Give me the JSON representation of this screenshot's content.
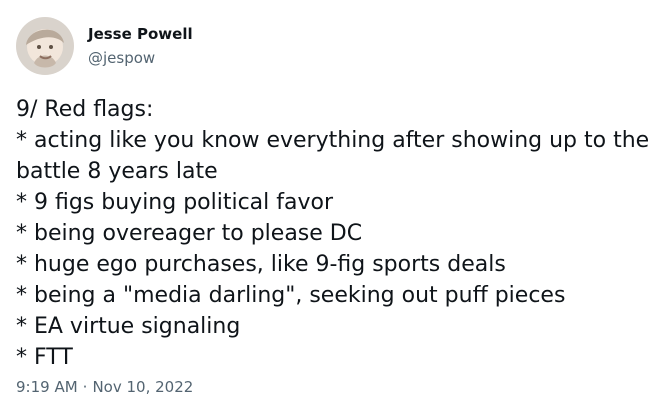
{
  "author": {
    "display_name": "Jesse Powell",
    "handle": "@jespow",
    "avatar_icon": "profile-photo-avatar"
  },
  "tweet": {
    "lines": [
      "9/ Red flags:",
      "* acting like you know everything after showing up to the",
      "battle 8 years late",
      "* 9 figs buying political favor",
      "* being overeager to please DC",
      "* huge ego purchases, like 9-fig sports deals",
      "* being a \"media darling\", seeking out puff pieces",
      "* EA virtue signaling",
      "* FTT"
    ]
  },
  "timestamp": {
    "time": "9:19 AM",
    "separator": "·",
    "date": "Nov 10, 2022"
  },
  "colors": {
    "text_primary": "#0f1419",
    "text_secondary": "#536471",
    "background": "#ffffff"
  }
}
